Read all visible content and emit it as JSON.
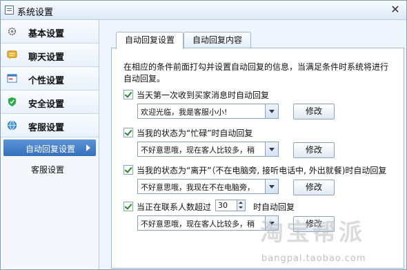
{
  "window": {
    "title": "系统设置",
    "close_glyph": "✕"
  },
  "sidebar": {
    "items": [
      {
        "label": "基本设置",
        "icon": "gear-icon"
      },
      {
        "label": "聊天设置",
        "icon": "chat-icon"
      },
      {
        "label": "个性设置",
        "icon": "window-icon"
      },
      {
        "label": "安全设置",
        "icon": "shield-icon"
      },
      {
        "label": "客服设置",
        "icon": "globe-icon"
      }
    ],
    "sub_items": [
      {
        "label": "自动回复设置",
        "active": true
      },
      {
        "label": "客服设置",
        "active": false
      }
    ]
  },
  "tabs": [
    {
      "label": "自动回复设置",
      "active": true
    },
    {
      "label": "自动回复内容",
      "active": false
    }
  ],
  "panel": {
    "description": "在相应的条件前面打勾并设置自动回复的信息，当满足条件时系统将进行自动回复。",
    "rules": [
      {
        "label": "当天第一次收到买家消息时自动回复",
        "checked": true,
        "reply": "欢迎光临，我是客服小小!",
        "button": "修改"
      },
      {
        "label": "当我的状态为“忙碌”时自动回复",
        "checked": true,
        "reply": "不好意思哦，现在客人比较多，稍",
        "button": "修改"
      },
      {
        "label": "当我的状态为“离开”（不在电脑旁, 接听电话中, 外出就餐)时自动回复",
        "checked": true,
        "reply": "不好意思哦，我现在不在电脑旁，",
        "button": "修改"
      },
      {
        "label_before": "当正在联系人数超过",
        "count": "30",
        "label_after": "时自动回复",
        "checked": true,
        "reply": "不好意思哦，现在客人比较多，稍",
        "button": "修改"
      }
    ]
  },
  "watermark": {
    "text": "淘宝帮派",
    "url": "bangpai.taobao.com"
  },
  "colors": {
    "active_blue": "#3570bd",
    "check_green": "#1e8a2a"
  }
}
